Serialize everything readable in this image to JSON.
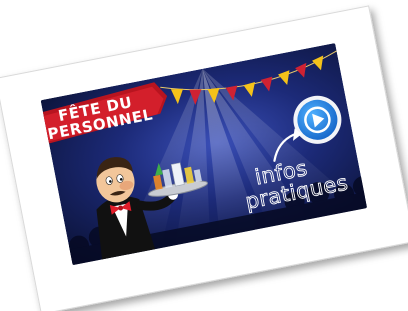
{
  "card": {
    "banner": {
      "line1": "FÊTE DU",
      "line2": "PERSONNEL"
    },
    "infos": {
      "line1": "infos",
      "line2": "pratiques"
    },
    "play_button": {
      "icon": "play-icon",
      "color": "#1f7fe0"
    }
  },
  "colors": {
    "background_dark": "#0b1235",
    "background_mid": "#1c2a78",
    "ribbon_red": "#d31f2b",
    "bunting_yellow": "#f4c21a",
    "bunting_red": "#cf2233",
    "play_blue": "#1f7fe0"
  }
}
